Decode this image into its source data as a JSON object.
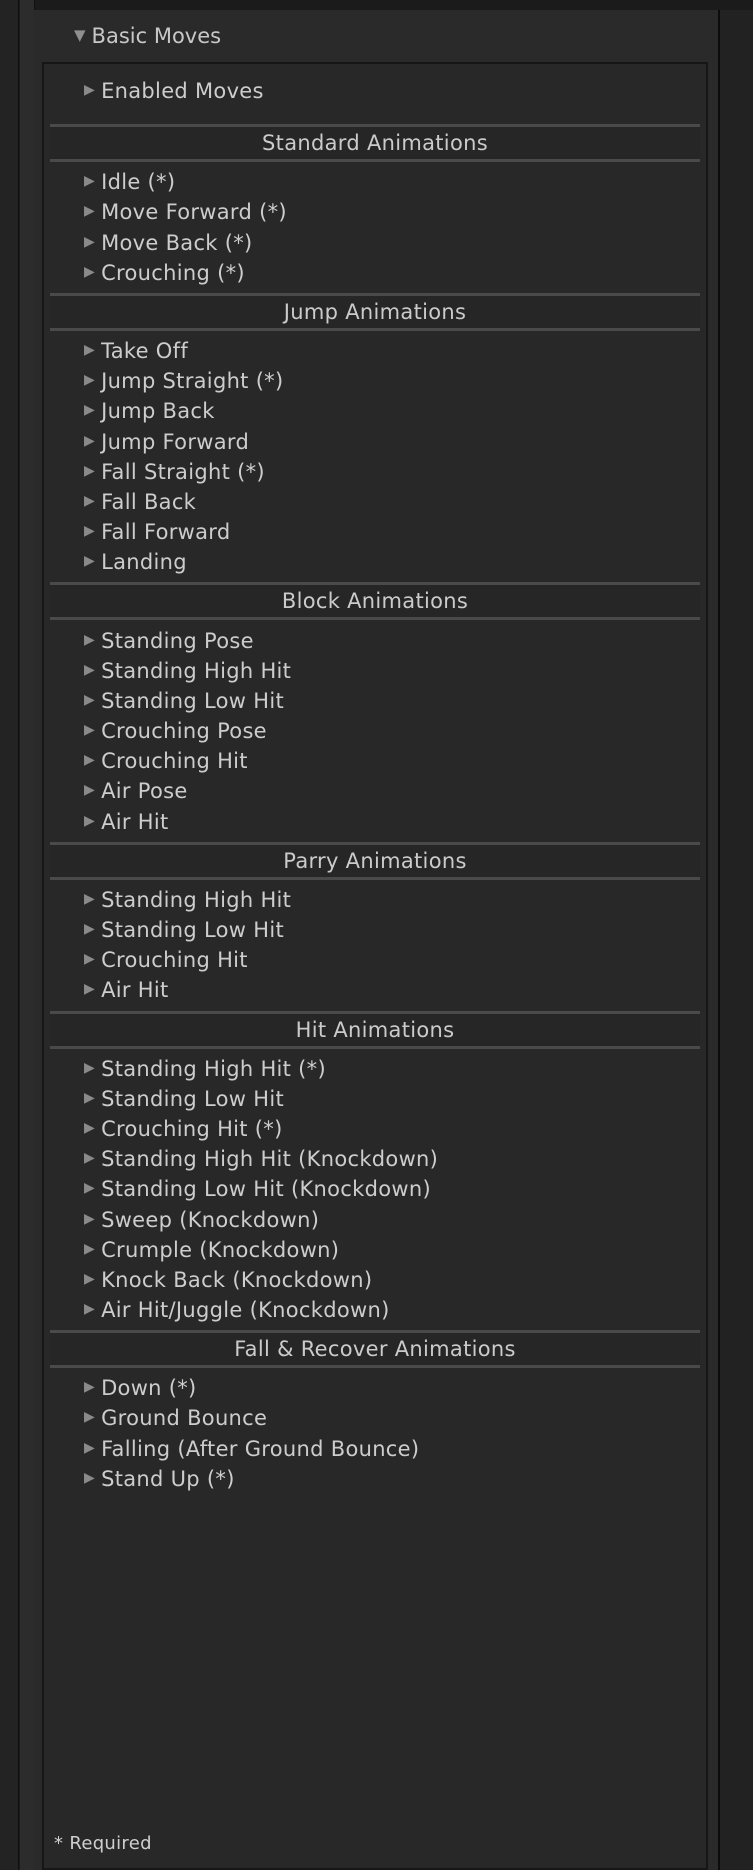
{
  "basic_moves": {
    "title": "Basic Moves",
    "expanded": true
  },
  "enabled_moves": {
    "label": "Enabled Moves"
  },
  "sections": [
    {
      "title": "Standard Animations",
      "items": [
        "Idle (*)",
        "Move Forward (*)",
        "Move Back (*)",
        "Crouching (*)"
      ]
    },
    {
      "title": "Jump Animations",
      "items": [
        "Take Off",
        "Jump Straight (*)",
        "Jump Back",
        "Jump Forward",
        "Fall Straight (*)",
        "Fall Back",
        "Fall Forward",
        "Landing"
      ]
    },
    {
      "title": "Block Animations",
      "items": [
        "Standing Pose",
        "Standing High Hit",
        "Standing Low Hit",
        "Crouching Pose",
        "Crouching Hit",
        "Air Pose",
        "Air Hit"
      ]
    },
    {
      "title": "Parry Animations",
      "items": [
        "Standing High Hit",
        "Standing Low Hit",
        "Crouching Hit",
        "Air Hit"
      ]
    },
    {
      "title": "Hit Animations",
      "items": [
        "Standing High Hit (*)",
        "Standing Low Hit",
        "Crouching Hit (*)",
        "Standing High Hit (Knockdown)",
        "Standing Low Hit (Knockdown)",
        "Sweep (Knockdown)",
        "Crumple (Knockdown)",
        "Knock Back (Knockdown)",
        "Air Hit/Juggle (Knockdown)"
      ]
    },
    {
      "title": "Fall & Recover Animations",
      "items": [
        "Down (*)",
        "Ground Bounce",
        "Falling (After Ground Bounce)",
        "Stand Up (*)"
      ]
    }
  ],
  "footnote": "* Required",
  "icons": {
    "collapsed": "triangle-right-icon",
    "expanded": "triangle-down-icon"
  },
  "colors": {
    "background": "#2a2a2a",
    "text": "#cdcdcd",
    "separator": "#4a4a4a"
  }
}
